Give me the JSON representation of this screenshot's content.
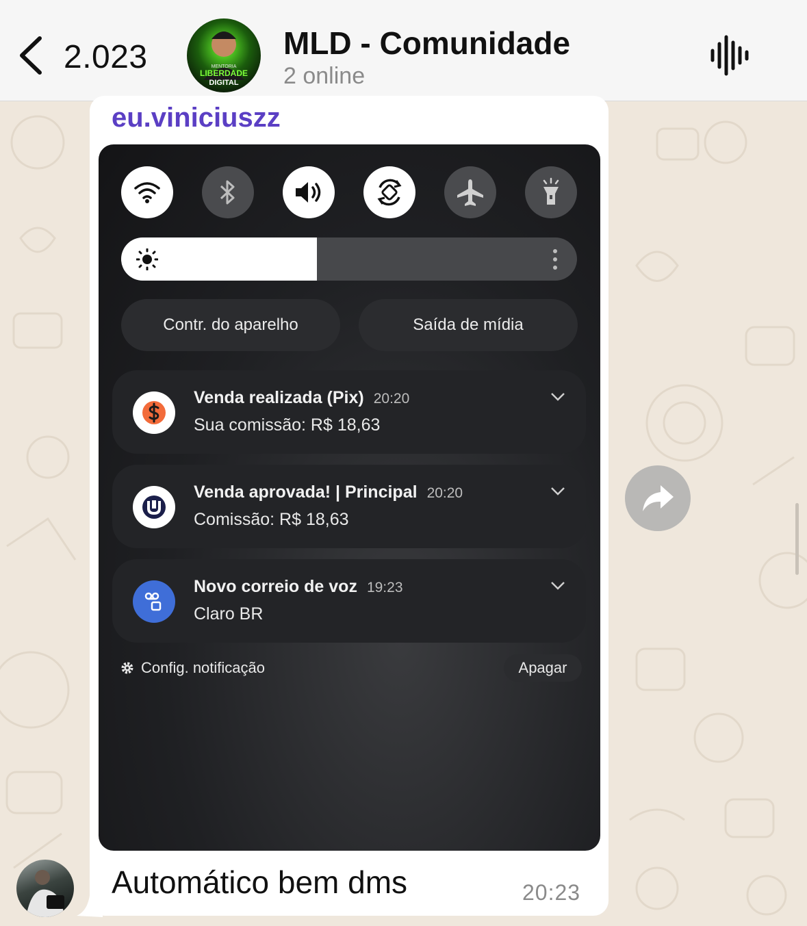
{
  "header": {
    "back_count": "2.023",
    "group_title": "MLD - Comunidade",
    "group_subtitle": "2 online",
    "avatar_text": [
      "MENTORIA",
      "LIBERDADE",
      "DIGITAL"
    ]
  },
  "message": {
    "sender": "eu.viniciuszz",
    "text": "Automático bem dms",
    "time": "20:23"
  },
  "screenshot": {
    "quick_settings": [
      {
        "name": "wifi",
        "state": "on"
      },
      {
        "name": "bluetooth",
        "state": "off"
      },
      {
        "name": "sound",
        "state": "on"
      },
      {
        "name": "auto-rotate",
        "state": "on"
      },
      {
        "name": "airplane",
        "state": "off"
      },
      {
        "name": "flashlight",
        "state": "off"
      }
    ],
    "brightness_level": 0.43,
    "device_control_label": "Contr. do aparelho",
    "media_output_label": "Saída de mídia",
    "notifications": [
      {
        "title": "Venda realizada (Pix)",
        "time": "20:20",
        "body": "Sua comissão: R$ 18,63",
        "icon": "dollar-icon",
        "icon_color": "#f26b3a"
      },
      {
        "title": "Venda aprovada! | Principal",
        "time": "20:20",
        "body": "Comissão: R$ 18,63",
        "icon": "app-logo-icon",
        "icon_color": "#1b1f4a"
      },
      {
        "title": "Novo correio de voz",
        "time": "19:23",
        "body": "Claro BR",
        "icon": "voicemail-icon",
        "icon_color": "#3f6ed8"
      }
    ],
    "settings_label": "Config. notificação",
    "clear_label": "Apagar"
  },
  "colors": {
    "sender_name": "#5b3fc4",
    "chat_background": "#efe7dc"
  }
}
